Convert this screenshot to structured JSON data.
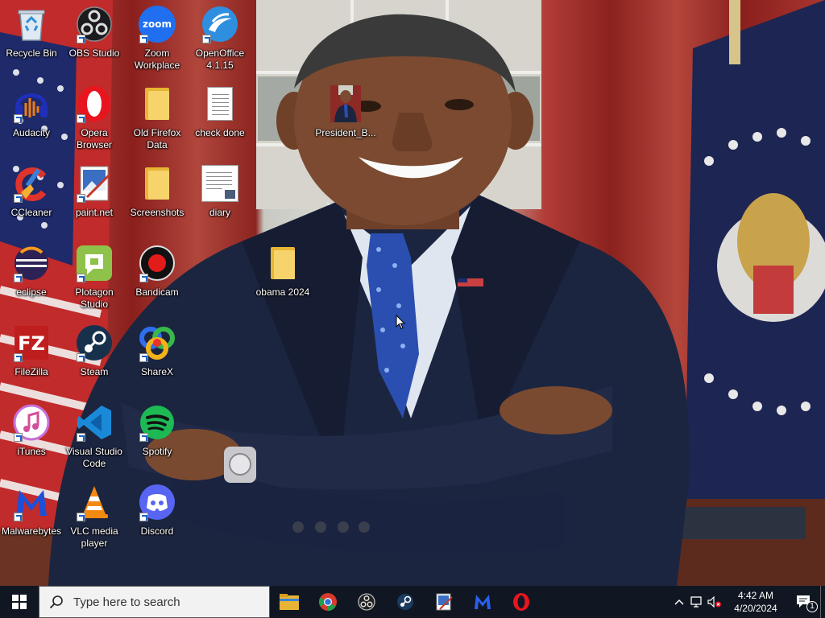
{
  "desktop": {
    "icons": [
      {
        "label": "Recycle Bin",
        "icon": "recycle-bin-icon"
      },
      {
        "label": "OBS Studio",
        "icon": "obs-studio-icon"
      },
      {
        "label": "Zoom Workplace",
        "icon": "zoom-icon"
      },
      {
        "label": "OpenOffice 4.1.15",
        "icon": "openoffice-icon"
      },
      {
        "label": "Audacity",
        "icon": "audacity-icon"
      },
      {
        "label": "Opera Browser",
        "icon": "opera-icon"
      },
      {
        "label": "Old Firefox Data",
        "icon": "folder-icon"
      },
      {
        "label": "check done",
        "icon": "text-document-icon"
      },
      {
        "label": "President_B...",
        "icon": "image-file-icon"
      },
      {
        "label": "CCleaner",
        "icon": "ccleaner-icon"
      },
      {
        "label": "paint.net",
        "icon": "paint-net-icon"
      },
      {
        "label": "Screenshots",
        "icon": "folder-icon"
      },
      {
        "label": "diary",
        "icon": "document-icon"
      },
      {
        "label": "eclipse",
        "icon": "eclipse-icon"
      },
      {
        "label": "Plotagon Studio",
        "icon": "plotagon-icon"
      },
      {
        "label": "Bandicam",
        "icon": "bandicam-icon"
      },
      {
        "label": "obama 2024",
        "icon": "folder-icon"
      },
      {
        "label": "FileZilla",
        "icon": "filezilla-icon"
      },
      {
        "label": "Steam",
        "icon": "steam-icon"
      },
      {
        "label": "ShareX",
        "icon": "sharex-icon"
      },
      {
        "label": "iTunes",
        "icon": "itunes-icon"
      },
      {
        "label": "Visual Studio Code",
        "icon": "vscode-icon"
      },
      {
        "label": "Spotify",
        "icon": "spotify-icon"
      },
      {
        "label": "Malwarebytes",
        "icon": "malwarebytes-icon"
      },
      {
        "label": "VLC media player",
        "icon": "vlc-icon"
      },
      {
        "label": "Discord",
        "icon": "discord-icon"
      }
    ]
  },
  "taskbar": {
    "search_placeholder": "Type here to search",
    "pinned_apps": [
      "file-explorer-icon",
      "chrome-icon",
      "obs-studio-icon",
      "steam-icon",
      "paint-net-icon",
      "malwarebytes-icon",
      "opera-icon"
    ],
    "tray": {
      "icons": [
        "show-hidden-icons-chevron",
        "network-icon",
        "volume-muted-icon"
      ],
      "time": "4:42 AM",
      "date": "4/20/2024",
      "notification_count": "1"
    }
  },
  "colors": {
    "taskbar": "#101722",
    "search_box": "#f2f2f2",
    "suit": "#1c2540",
    "tie": "#2a4fb0",
    "curtain_red": "#a3322d"
  }
}
